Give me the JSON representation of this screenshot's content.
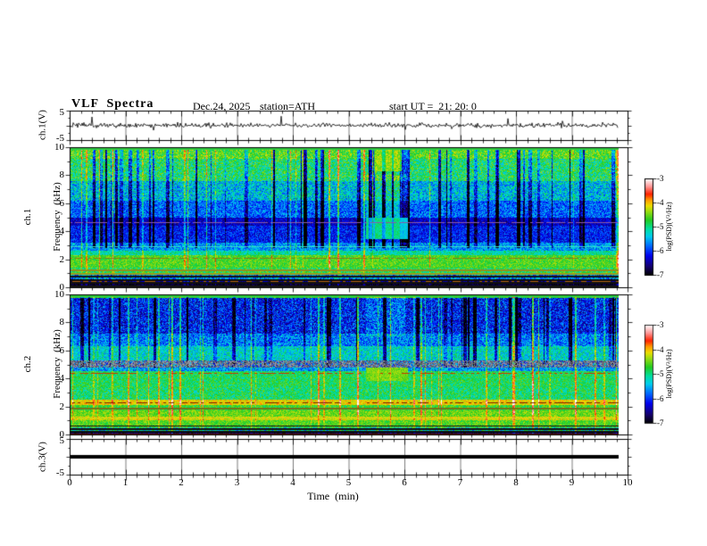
{
  "chart_data": {
    "type": "heatmap",
    "title": "VLF  Spectra",
    "annotations": {
      "date": "Dec.24, 2025",
      "station": "station=ATH",
      "start_ut": "start UT =  21: 20: 0"
    },
    "x_axis": {
      "label": "Time  (min)",
      "min": 0,
      "max": 10,
      "major_ticks": [
        0,
        1,
        2,
        3,
        4,
        5,
        6,
        7,
        8,
        9,
        10
      ],
      "minor_step": 0.2,
      "data_end_min": 9.84
    },
    "colorbar": {
      "label": "log(PSD)(V²/Hz)",
      "ticks": [
        "-3",
        "-4",
        "-5",
        "-6",
        "-7"
      ],
      "vmax": -3,
      "vmin": -7,
      "colormap_stops": [
        [
          0.0,
          "#000000"
        ],
        [
          0.09,
          "#15006e"
        ],
        [
          0.2,
          "#0000ee"
        ],
        [
          0.3,
          "#0066ff"
        ],
        [
          0.4,
          "#00ccee"
        ],
        [
          0.48,
          "#00e0a0"
        ],
        [
          0.57,
          "#22cc22"
        ],
        [
          0.66,
          "#99dd11"
        ],
        [
          0.72,
          "#eedd00"
        ],
        [
          0.78,
          "#ff9900"
        ],
        [
          0.84,
          "#ff2200"
        ],
        [
          0.92,
          "#ff9999"
        ],
        [
          1.0,
          "#ffffff"
        ]
      ]
    },
    "panels": [
      {
        "id": "ch1_waveform",
        "type": "line",
        "ylabel": "ch.1(V)",
        "ymin": -5,
        "ymax": 5,
        "ytick_values": [
          5,
          -5
        ],
        "ytick_labels": [
          "5",
          "-5"
        ],
        "noise_std": 0.38,
        "spike_prob": 0.018,
        "spike_max": 3.2,
        "seed": 20251224
      },
      {
        "id": "ch1_spectrogram",
        "type": "heatmap",
        "ylabel_channel": "ch.1",
        "ylabel_axis": "Frequency  (kHz)",
        "ymin": 0,
        "ymax": 10,
        "ytick_values": [
          10,
          8,
          6,
          4,
          2,
          0
        ],
        "ytick_labels": [
          "10",
          "8",
          "6",
          "4",
          "2",
          "0"
        ],
        "seed": 771,
        "bands": [
          [
            9.2,
            10.0,
            -4.6,
            0.4
          ],
          [
            7.6,
            9.2,
            -4.9,
            0.5
          ],
          [
            6.2,
            7.6,
            -5.4,
            0.5
          ],
          [
            5.0,
            6.2,
            -5.8,
            0.4
          ],
          [
            4.4,
            5.0,
            -6.35,
            0.28
          ],
          [
            3.2,
            4.4,
            -6.1,
            0.36
          ],
          [
            2.6,
            3.2,
            -5.6,
            0.4
          ],
          [
            2.3,
            2.6,
            -5.1,
            0.32
          ],
          [
            1.4,
            2.3,
            -4.6,
            0.28
          ],
          [
            0.9,
            1.4,
            -4.8,
            0.4
          ],
          [
            0.5,
            0.9,
            -5.6,
            0.6
          ],
          [
            0.25,
            0.5,
            -6.5,
            0.32
          ],
          [
            0.0,
            0.25,
            -6.85,
            0.16
          ]
        ],
        "hlines": [
          [
            9.95,
            2,
            "#33cc44",
            1
          ],
          [
            4.62,
            1,
            "#8a5aa8",
            0.85
          ],
          [
            2.9,
            1,
            "#33ddcc",
            0.9
          ],
          [
            2.08,
            1,
            "#8a7a14",
            0.7
          ],
          [
            1.3,
            2,
            "#8f8f20",
            1
          ],
          [
            1.05,
            2,
            "#9a9a1e",
            1
          ],
          [
            0.8,
            2,
            "#121212",
            1
          ],
          [
            0.58,
            2,
            "#0d0d0d",
            1
          ],
          [
            0.44,
            1,
            "#b06010",
            0.4
          ],
          [
            0.36,
            2,
            "#101010",
            1
          ],
          [
            0.15,
            2,
            "#141414",
            1
          ]
        ],
        "streaks": {
          "p_dark": 0.085,
          "dark_len_max": 4,
          "dark_amt": [
            0.6,
            1.8
          ],
          "dark_fmin": 2.8,
          "p_bright": 0.05,
          "bright_len_max": 2,
          "bright_amt": [
            0.45,
            1.1
          ]
        },
        "patches": [
          {
            "x0": 5.3,
            "x1": 6.05,
            "f0": 3.45,
            "f1": 4.95,
            "psd": -5.0,
            "sig": 0.2,
            "mode": "set"
          },
          {
            "x0": 5.3,
            "x1": 6.05,
            "f0": 4.95,
            "f1": 8.0,
            "dpsd": 0.4,
            "mode": "add"
          },
          {
            "x0": 5.45,
            "x1": 5.95,
            "f0": 8.3,
            "f1": 10.0,
            "psd": -4.35,
            "sig": 0.3,
            "mode": "set"
          }
        ]
      },
      {
        "id": "ch2_spectrogram",
        "type": "heatmap",
        "ylabel_channel": "ch.2",
        "ylabel_axis": "Frequency  (kHz)",
        "ymin": 0,
        "ymax": 10,
        "ytick_values": [
          10,
          8,
          6,
          4,
          2,
          0
        ],
        "ytick_labels": [
          "10",
          "8",
          "6",
          "4",
          "2",
          "0"
        ],
        "seed": 992,
        "gray_band": [
          4.8,
          5.3
        ],
        "bands": [
          [
            9.75,
            10.0,
            -4.7,
            0.25
          ],
          [
            7.2,
            9.75,
            -6.1,
            0.5
          ],
          [
            6.3,
            7.2,
            -5.7,
            0.45
          ],
          [
            5.3,
            6.3,
            -5.25,
            0.4
          ],
          [
            4.8,
            5.3,
            -5.8,
            0.5
          ],
          [
            4.55,
            4.8,
            -5.6,
            0.4
          ],
          [
            3.4,
            4.55,
            -4.85,
            0.35
          ],
          [
            2.5,
            3.4,
            -4.9,
            0.4
          ],
          [
            2.1,
            2.5,
            -4.1,
            0.25
          ],
          [
            1.7,
            2.1,
            -4.7,
            0.3
          ],
          [
            1.3,
            1.7,
            -4.5,
            0.25
          ],
          [
            1.05,
            1.3,
            -4.2,
            0.25
          ],
          [
            0.5,
            1.05,
            -4.6,
            0.28
          ],
          [
            0.2,
            0.5,
            -5.2,
            0.6
          ],
          [
            0.0,
            0.2,
            -6.75,
            0.25
          ]
        ],
        "hlines": [
          [
            9.95,
            2,
            "#2bc83a",
            1
          ],
          [
            4.42,
            1,
            "#cc3300",
            0.5
          ],
          [
            2.3,
            1,
            "#7a2400",
            0.55
          ],
          [
            1.9,
            2,
            "#73731a",
            1
          ],
          [
            1.22,
            1,
            "#d8d818",
            0.9
          ],
          [
            0.62,
            1,
            "#141414",
            1
          ],
          [
            0.42,
            2,
            "#101010",
            1
          ],
          [
            0.25,
            2,
            "#0e0e0e",
            1
          ],
          [
            0.06,
            2,
            "#5a1000",
            1
          ]
        ],
        "streaks": {
          "p_dark": 0.08,
          "dark_len_max": 4,
          "dark_amt": [
            0.5,
            1.4
          ],
          "dark_fmin": 4.8,
          "p_bright": 0.07,
          "bright_len_max": 2,
          "bright_amt": [
            0.5,
            1.2
          ]
        },
        "patches": [
          {
            "x0": 5.3,
            "x1": 6.05,
            "f0": 3.85,
            "f1": 4.75,
            "psd": -4.45,
            "sig": 0.2,
            "mode": "set"
          },
          {
            "x0": 5.3,
            "x1": 6.0,
            "f0": 7.0,
            "f1": 10.0,
            "dpsd": 0.3,
            "mode": "add"
          }
        ]
      },
      {
        "id": "ch3_waveform",
        "type": "line",
        "ylabel": "ch.3(V)",
        "ymin": -5,
        "ymax": 5,
        "ytick_values": [
          5,
          -5
        ],
        "ytick_labels": [
          "5",
          "-5"
        ],
        "flat_value": 0,
        "line_thickness_px": 4
      }
    ]
  }
}
